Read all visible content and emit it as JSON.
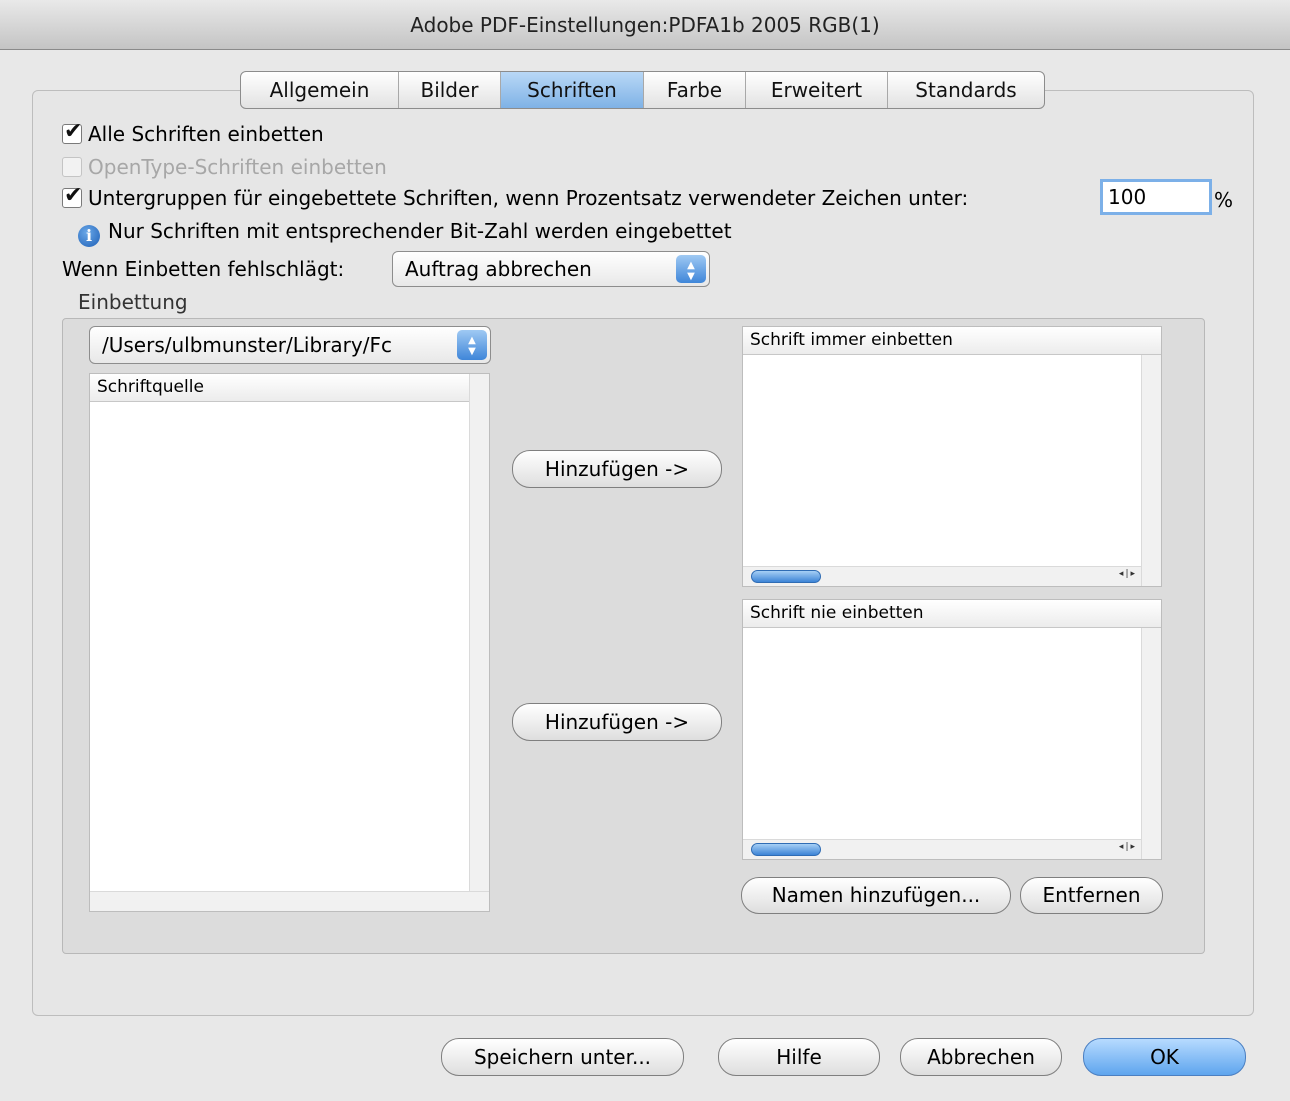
{
  "window": {
    "title": "Adobe PDF-Einstellungen:PDFA1b 2005 RGB(1)"
  },
  "tabs": [
    {
      "label": "Allgemein",
      "active": false
    },
    {
      "label": "Bilder",
      "active": false
    },
    {
      "label": "Schriften",
      "active": true
    },
    {
      "label": "Farbe",
      "active": false
    },
    {
      "label": "Erweitert",
      "active": false
    },
    {
      "label": "Standards",
      "active": false
    }
  ],
  "options": {
    "embed_all": {
      "label": "Alle Schriften einbetten",
      "checked": true
    },
    "embed_opentype": {
      "label": "OpenType-Schriften einbetten",
      "checked": false,
      "enabled": false
    },
    "subset": {
      "label": "Untergruppen für eingebettete Schriften, wenn Prozentsatz verwendeter Zeichen unter:",
      "checked": true,
      "value": "100",
      "unit": "%"
    },
    "info_text": "Nur Schriften mit entsprechender Bit-Zahl werden eingebettet",
    "on_fail_label": "Wenn Einbetten fehlschlägt:",
    "on_fail_value": "Auftrag abbrechen"
  },
  "embedding": {
    "group_label": "Einbettung",
    "source_path": "/Users/ulbmunster/Library/Fc",
    "source_header": "Schriftquelle",
    "always_header": "Schrift immer einbetten",
    "never_header": "Schrift nie einbetten",
    "add_always_label": "Hinzufügen ->",
    "add_never_label": "Hinzufügen ->",
    "add_names_label": "Namen hinzufügen...",
    "remove_label": "Entfernen"
  },
  "footer": {
    "save_as": "Speichern unter...",
    "help": "Hilfe",
    "cancel": "Abbrechen",
    "ok": "OK"
  },
  "colors": {
    "accent": "#5ea5ee",
    "selected_tab": "#7fb2e6"
  }
}
